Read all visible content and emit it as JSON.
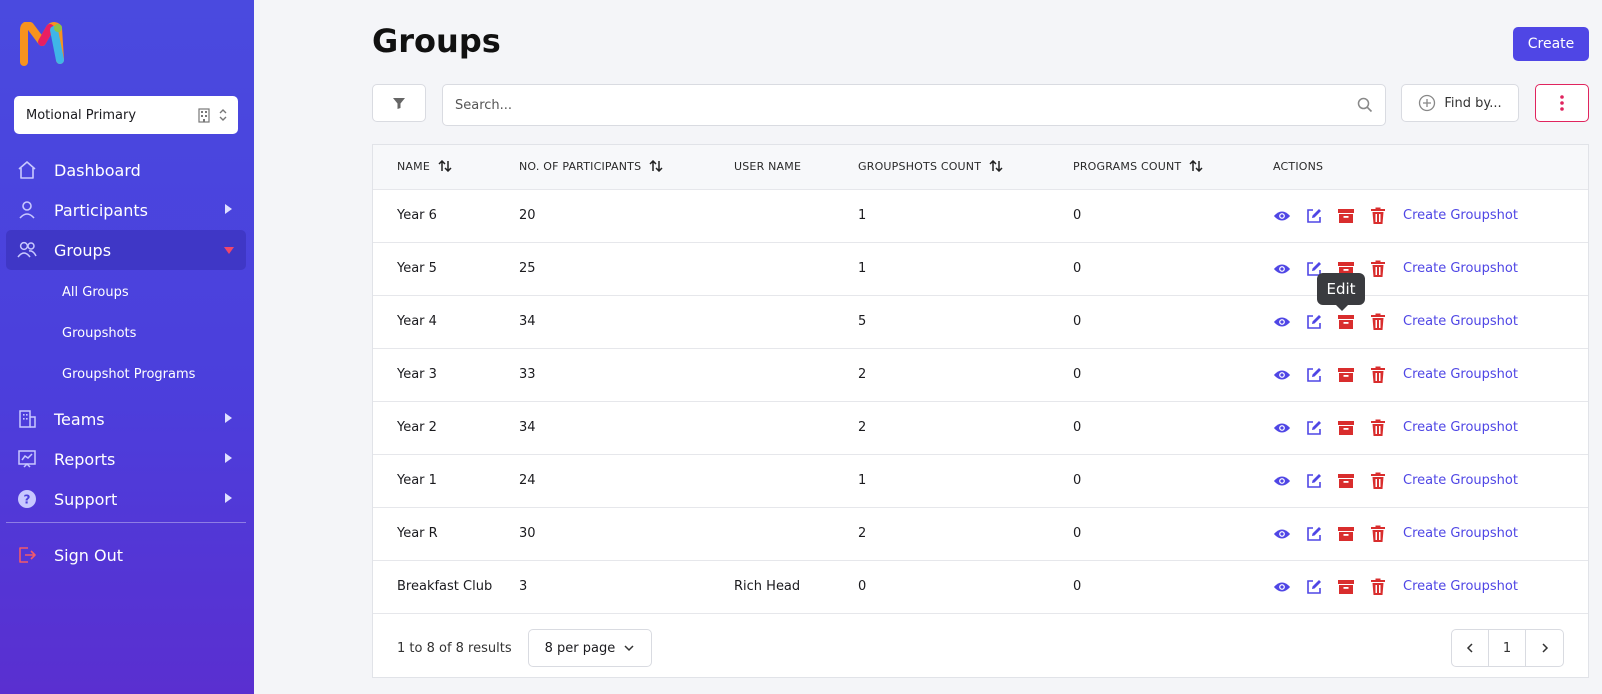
{
  "sidebar": {
    "team": "Motional Primary",
    "items": [
      {
        "label": "Dashboard",
        "icon": "home-icon"
      },
      {
        "label": "Participants",
        "icon": "user-icon"
      },
      {
        "label": "Groups",
        "icon": "users-icon"
      },
      {
        "label": "Teams",
        "icon": "building-icon"
      },
      {
        "label": "Reports",
        "icon": "chart-icon"
      },
      {
        "label": "Support",
        "icon": "help-icon"
      }
    ],
    "sub_items": [
      "All Groups",
      "Groupshots",
      "Groupshot Programs"
    ],
    "signout": "Sign Out"
  },
  "header": {
    "title": "Groups",
    "create_label": "Create"
  },
  "toolbar": {
    "search_placeholder": "Search...",
    "findby_label": "Find by..."
  },
  "table": {
    "columns": [
      "NAME",
      "NO. OF PARTICIPANTS",
      "USER NAME",
      "GROUPSHOTS COUNT",
      "PROGRAMS COUNT",
      "ACTIONS"
    ],
    "action_link": "Create Groupshot",
    "rows": [
      {
        "name": "Year 6",
        "participants": "20",
        "user": "",
        "groupshots": "1",
        "programs": "0"
      },
      {
        "name": "Year 5",
        "participants": "25",
        "user": "",
        "groupshots": "1",
        "programs": "0"
      },
      {
        "name": "Year 4",
        "participants": "34",
        "user": "",
        "groupshots": "5",
        "programs": "0"
      },
      {
        "name": "Year 3",
        "participants": "33",
        "user": "",
        "groupshots": "2",
        "programs": "0"
      },
      {
        "name": "Year 2",
        "participants": "34",
        "user": "",
        "groupshots": "2",
        "programs": "0"
      },
      {
        "name": "Year 1",
        "participants": "24",
        "user": "",
        "groupshots": "1",
        "programs": "0"
      },
      {
        "name": "Year R",
        "participants": "30",
        "user": "",
        "groupshots": "2",
        "programs": "0"
      },
      {
        "name": "Breakfast Club",
        "participants": "3",
        "user": "Rich Head",
        "groupshots": "0",
        "programs": "0"
      }
    ]
  },
  "tooltip": "Edit",
  "footer": {
    "results": "1 to 8 of 8 results",
    "per_page": "8 per page",
    "page": "1"
  },
  "colors": {
    "accent": "#4f46e5",
    "danger": "#d92d2d",
    "sidebar_top": "#4a4adf",
    "sidebar_bottom": "#5a2fd0"
  }
}
